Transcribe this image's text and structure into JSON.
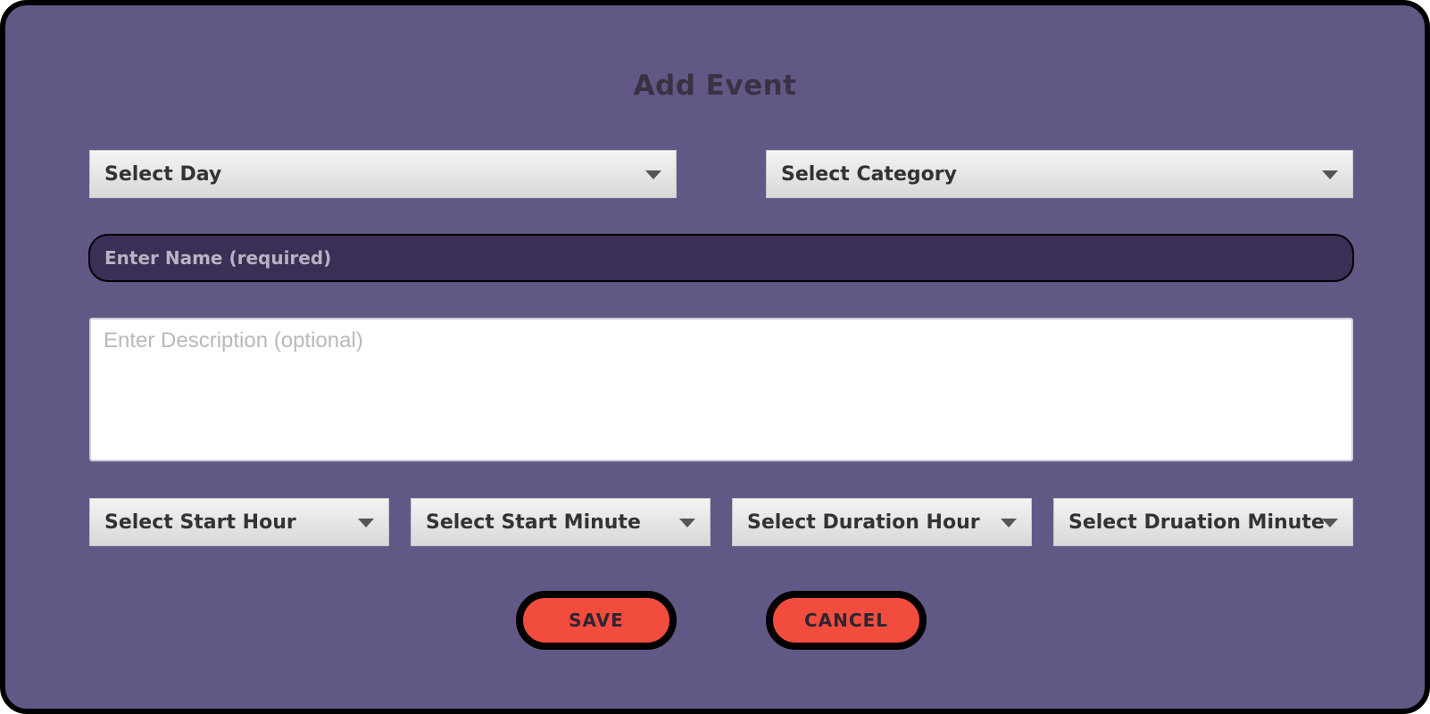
{
  "dialog": {
    "title": "Add Event"
  },
  "selects": {
    "day": "Select Day",
    "category": "Select Category",
    "start_hour": "Select Start Hour",
    "start_minute": "Select Start Minute",
    "duration_hour": "Select Duration Hour",
    "duration_minute": "Select Druation Minute"
  },
  "inputs": {
    "name_placeholder": "Enter Name (required)",
    "description_placeholder": "Enter Description (optional)"
  },
  "buttons": {
    "save": "SAVE",
    "cancel": "CANCEL"
  },
  "colors": {
    "background": "#625886",
    "name_field": "#3b2f55",
    "button": "#f24c3e"
  },
  "icons": {
    "dropdown": "chevron-down-icon"
  }
}
